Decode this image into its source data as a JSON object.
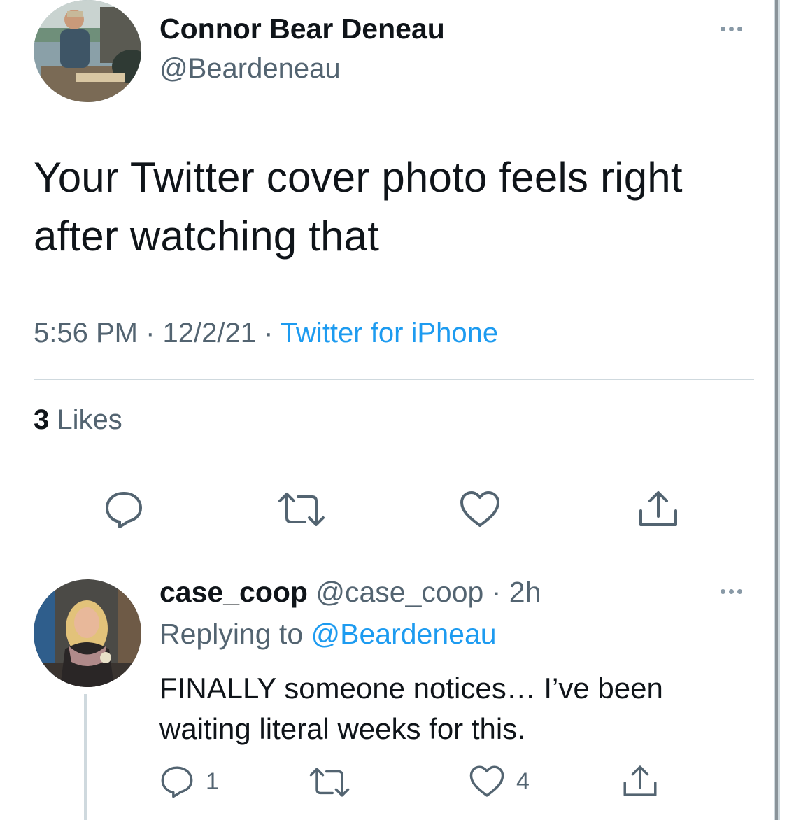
{
  "tweet": {
    "author_name": "Connor Bear Deneau",
    "author_handle": "@Beardeneau",
    "text": "Your Twitter cover photo feels right after watching that",
    "time": "5:56 PM",
    "separator": " · ",
    "date": "12/2/21",
    "source": "Twitter for iPhone",
    "likes_count": "3",
    "likes_label": "Likes"
  },
  "reply": {
    "author_name": "case_coop",
    "author_handle": "@case_coop",
    "separator": " · ",
    "age": "2h",
    "replying_to_label": "Replying to ",
    "replying_to_handle": "@Beardeneau",
    "text": "FINALLY someone notices… I’ve been waiting literal weeks for this.",
    "reply_count": "1",
    "like_count": "4"
  },
  "icons": {
    "reply": "reply-icon",
    "retweet": "retweet-icon",
    "like": "heart-icon",
    "share": "share-icon",
    "more": "more-icon"
  },
  "colors": {
    "accent": "#1d9bf0",
    "secondary_text": "#536471",
    "primary_text": "#0f1419",
    "divider": "#cfd9de"
  }
}
